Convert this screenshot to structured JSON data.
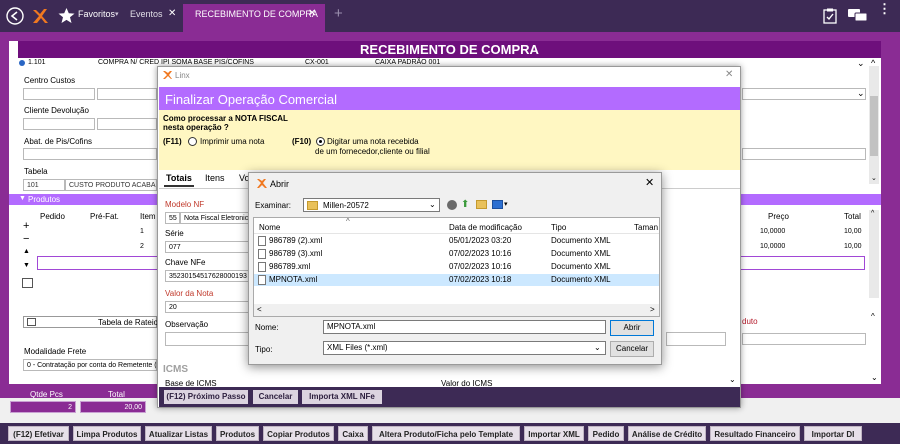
{
  "topbar": {
    "tabs": [
      "Favoritos",
      "Eventos",
      "RECEBIMENTO DE COMPRA"
    ],
    "add_tab": "+"
  },
  "banner": "RECEBIMENTO DE COMPRA",
  "main": {
    "row1": [
      "1.101",
      "COMPRA N/ CRED IPI SOMA BASE PIS/COFINS",
      "CX-001",
      "CAIXA PADRÃO 001"
    ],
    "labels": {
      "centro_custos": "Centro Custos",
      "cliente_devolucao": "Cliente Devolução",
      "abat": "Abat. de Pis/Cofins",
      "tabela": "Tabela",
      "modalidade": "Modalidade Frete",
      "tabela_rateio": "Tabela de Rateio",
      "produtos": "Produtos",
      "preco": "Preço",
      "total": "Total",
      "qtde_pcs": "Qtde Pcs",
      "total2": "Total",
      "duto": "duto"
    },
    "tabela_code": "101",
    "tabela_name": "CUSTO PRODUTO ACABADO",
    "modalidade_value": "0 - Contratação por conta do Remetente (CIF)",
    "products": {
      "headers": [
        "Pedido",
        "Pré-Fat.",
        "Item"
      ],
      "items": [
        "1",
        "2"
      ],
      "precos": [
        "10,0000",
        "10,0000"
      ],
      "totais": [
        "10,00",
        "10,00"
      ]
    },
    "qtde_pcs_value": "2",
    "total_value": "20,00"
  },
  "finalizar": {
    "window_title": "Linx",
    "heading": "Finalizar Operação Comercial",
    "question_line1": "Como processar a NOTA FISCAL",
    "question_line2": "nesta operação ?",
    "opt_f11_key": "(F11)",
    "opt_f11_label": "Imprimir uma nota",
    "opt_f10_key": "(F10)",
    "opt_f10_label1": "Digitar uma nota recebida",
    "opt_f10_label2": "de um fornecedor,cliente ou filial",
    "tabs": [
      "Totais",
      "Itens",
      "Vo"
    ],
    "modelo_label": "Modelo NF",
    "modelo_code": "55",
    "modelo_desc": "Nota Fiscal Eletronica",
    "serie_label": "Série",
    "serie_value": "077",
    "chave_label": "Chave NFe",
    "chave_value": "35230154517628000193",
    "valor_label": "Valor da Nota",
    "valor_value": "20",
    "obs_label": "Observação",
    "icms_heading": "ICMS",
    "base_icms": "Base de ICMS",
    "valor_icms": "Valor do ICMS",
    "btn_f12": "(F12) Próximo Passo",
    "btn_cancelar": "Cancelar",
    "btn_importa": "Importa XML NFe"
  },
  "abrir": {
    "title": "Abrir",
    "examinar_label": "Examinar:",
    "folder": "Millen-20572",
    "columns": [
      "Nome",
      "Data de modificação",
      "Tipo",
      "Taman"
    ],
    "files": [
      {
        "name": "986789 (2).xml",
        "date": "05/01/2023 03:20",
        "type": "Documento XML"
      },
      {
        "name": "986789 (3).xml",
        "date": "07/02/2023 10:16",
        "type": "Documento XML"
      },
      {
        "name": "986789.xml",
        "date": "07/02/2023 10:16",
        "type": "Documento XML"
      },
      {
        "name": "MPNOTA.xml",
        "date": "07/02/2023 10:18",
        "type": "Documento XML"
      }
    ],
    "nome_label": "Nome:",
    "nome_value": "MPNOTA.xml",
    "tipo_label": "Tipo:",
    "tipo_value": "XML Files (*.xml)",
    "btn_abrir": "Abrir",
    "btn_cancelar": "Cancelar"
  },
  "bottom_buttons": [
    "(F12) Efetivar",
    "Limpa Produtos",
    "Atualizar Listas",
    "Produtos",
    "Copiar Produtos",
    "Caixa",
    "Altera Produto/Ficha pelo Template",
    "Importar XML",
    "Pedido",
    "Análise de Crédito",
    "Resultado Financeiro",
    "Importar DI"
  ],
  "colors": {
    "purple": "#8a2c94",
    "dark": "#3d2a55",
    "accent": "#b36bff"
  }
}
